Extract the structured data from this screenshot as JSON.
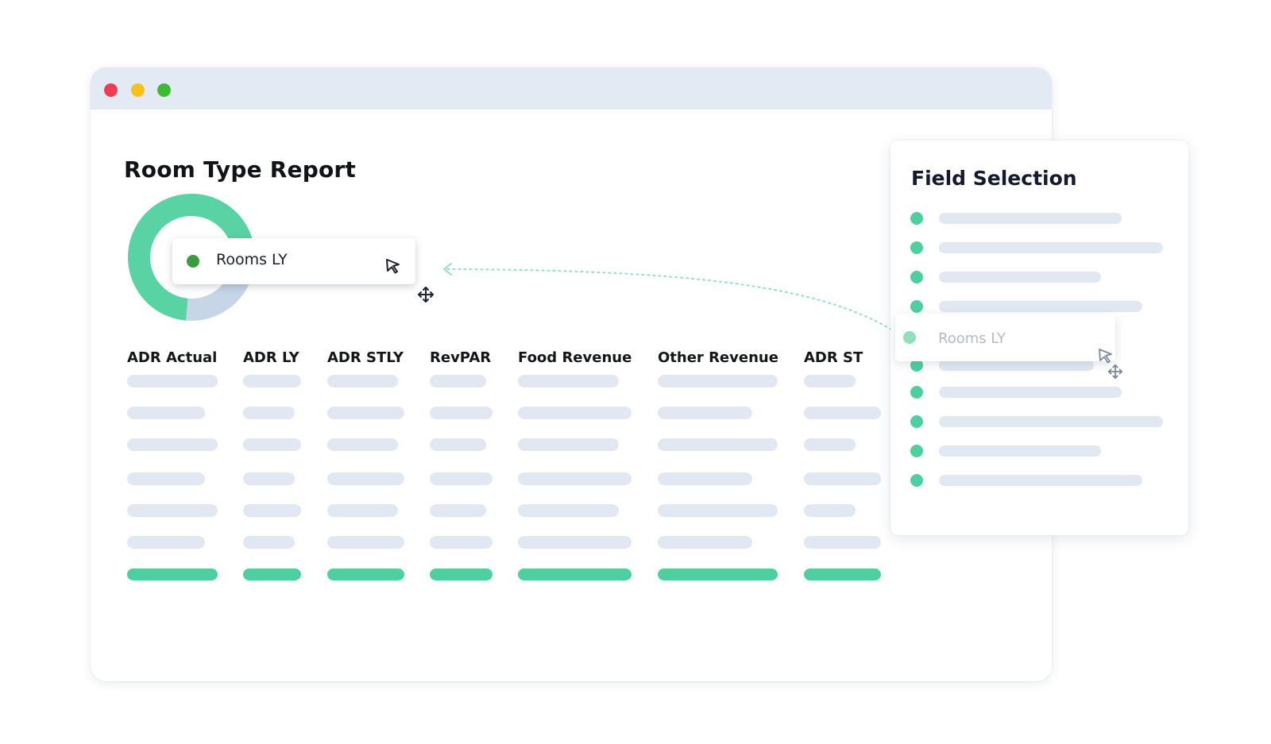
{
  "window": {
    "title_dots": [
      "close",
      "minimize",
      "maximize"
    ],
    "dot_colors": [
      "#ef3c52",
      "#f6c21a",
      "#3fba35"
    ]
  },
  "report": {
    "title": "Room Type Report",
    "donut": {
      "filled_fraction": 0.7,
      "fill_color": "#5ad3a4",
      "rest_color": "#c6d6e6"
    },
    "tooltip": {
      "label": "Rooms LY",
      "dot_color": "#3c9b42"
    },
    "columns": [
      "ADR Actual",
      "ADR LY",
      "ADR STLY",
      "RevPAR",
      "Food Revenue",
      "Other Revenue",
      "ADR ST"
    ],
    "placeholder_rows": 6,
    "total_row_color": "#4fcf9e"
  },
  "field_selection": {
    "title": "Field Selection",
    "dot_color": "#4fcf9e",
    "field_count": 10,
    "dragging_item": {
      "label": "Rooms LY"
    }
  },
  "icons": [
    "cursor-arrow-icon",
    "move-icon"
  ]
}
